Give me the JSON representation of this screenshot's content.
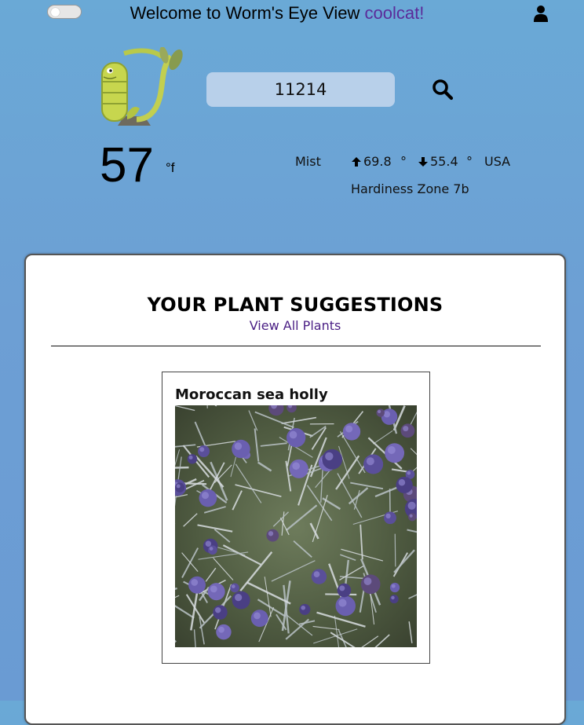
{
  "header": {
    "welcome_prefix": "Welcome to Worm's Eye View ",
    "username": "coolcat!",
    "toggle_state": "off",
    "user_icon": "user-icon"
  },
  "search": {
    "value": "11214",
    "icon": "search-icon"
  },
  "weather": {
    "temperature": "57",
    "unit": "°f",
    "condition": "Mist",
    "high": "69.8",
    "low": "55.4",
    "degree_symbol": "°",
    "country": "USA",
    "zone": "Hardiness Zone 7b"
  },
  "suggestions": {
    "title": "YOUR PLANT SUGGESTIONS",
    "view_all": "View All Plants",
    "plants": [
      {
        "name": "Moroccan sea holly"
      }
    ]
  },
  "colors": {
    "background": "#6aa9d6",
    "accent": "#5b2b9a",
    "search_bg": "#b8d0ea"
  }
}
